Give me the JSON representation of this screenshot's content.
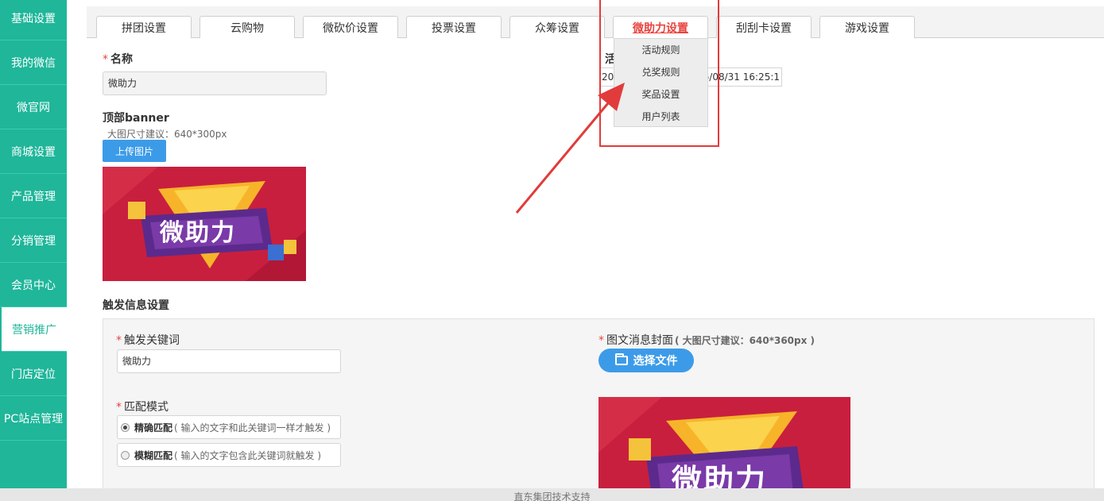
{
  "sidebar": {
    "items": [
      {
        "label": "基础设置"
      },
      {
        "label": "我的微信"
      },
      {
        "label": "微官网"
      },
      {
        "label": "商城设置"
      },
      {
        "label": "产品管理"
      },
      {
        "label": "分销管理"
      },
      {
        "label": "会员中心"
      },
      {
        "label": "营销推广"
      },
      {
        "label": "门店定位"
      },
      {
        "label": "PC站点管理"
      }
    ]
  },
  "tabs": [
    {
      "label": "拼团设置"
    },
    {
      "label": "云购物"
    },
    {
      "label": "微砍价设置"
    },
    {
      "label": "投票设置"
    },
    {
      "label": "众筹设置"
    },
    {
      "label": "微助力设置"
    },
    {
      "label": "刮刮卡设置"
    },
    {
      "label": "游戏设置"
    }
  ],
  "dropdown": {
    "items": [
      {
        "label": "活动规则"
      },
      {
        "label": "兑奖规则"
      },
      {
        "label": "奖品设置"
      },
      {
        "label": "用户列表"
      }
    ]
  },
  "form": {
    "name_label": "名称",
    "name_value": "微助力",
    "activity_label_partial": "活",
    "time_start_partial": "20",
    "time_end_partial": "16/08/31 16:25:1",
    "banner_label": "顶部banner",
    "banner_hint": "大图尺寸建议：640*300px",
    "upload_label": "上传图片",
    "banner_text": "微助力",
    "trigger_section": "触发信息设置",
    "keyword_label": "触发关键词",
    "keyword_value": "微助力",
    "cover_label": "图文消息封面",
    "cover_hint": "( 大图尺寸建议：640*360px )",
    "choose_file_label": "选择文件",
    "match_label": "匹配模式",
    "exact_label": "精确匹配",
    "exact_hint": "( 输入的文字和此关键词一样才触发 )",
    "fuzzy_label": "模糊匹配",
    "fuzzy_hint": "( 输入的文字包含此关键词就触发 )",
    "cover_text": "微助力"
  },
  "footer": {
    "text": "直东集团技术支持"
  },
  "colors": {
    "sidebar": "#1fb69a",
    "accent_red": "#e8433f",
    "button_blue": "#3c9be8"
  }
}
